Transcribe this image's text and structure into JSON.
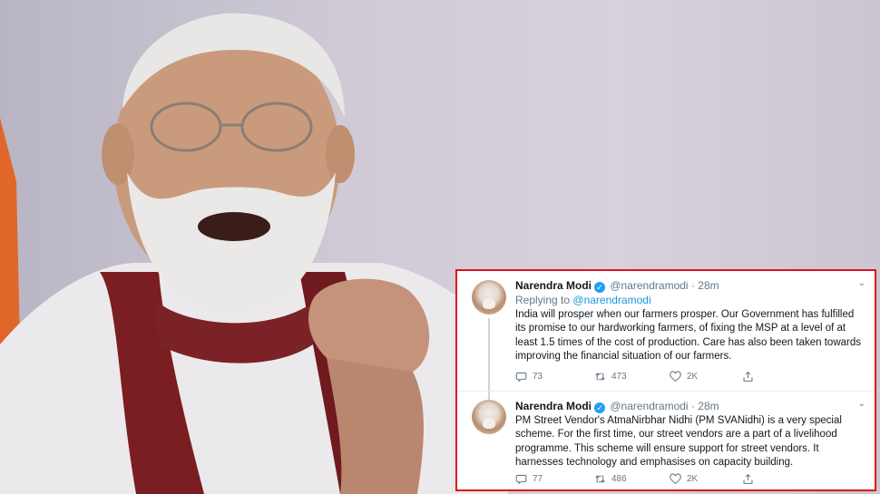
{
  "tweets": [
    {
      "name": "Narendra Modi",
      "handle": "@narendramodi",
      "sep": "·",
      "time": "28m",
      "replying_label": "Replying to",
      "replying_handle": "@narendramodi",
      "text": "India will prosper when our farmers prosper. Our Government has fulfilled its promise to our hardworking farmers, of fixing the MSP at a level of at least 1.5 times of the cost of production. Care has also been taken towards improving the financial situation of our farmers.",
      "replies": "73",
      "retweets": "473",
      "likes": "2K"
    },
    {
      "name": "Narendra Modi",
      "handle": "@narendramodi",
      "sep": "·",
      "time": "28m",
      "text": "PM Street Vendor's AtmaNirbhar Nidhi (PM SVANidhi) is a very special scheme. For the first time, our street vendors are a part of a livelihood programme. This scheme will ensure support for street vendors. It harnesses technology and emphasises on capacity building.",
      "replies": "77",
      "retweets": "486",
      "likes": "2K"
    }
  ],
  "icons": {
    "verified": "verified-badge-icon",
    "chevron": "chevron-down-icon",
    "reply": "reply-icon",
    "retweet": "retweet-icon",
    "like": "heart-icon",
    "share": "share-icon"
  },
  "colors": {
    "highlight_border": "#e0101a",
    "twitter_blue": "#1da1f2",
    "muted_text": "#657786"
  }
}
